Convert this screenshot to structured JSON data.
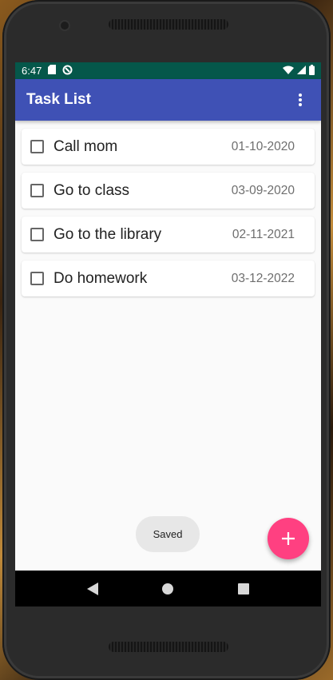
{
  "status_bar": {
    "time": "6:47",
    "icons_left": [
      "sd-card-icon",
      "sync-icon"
    ],
    "icons_right": [
      "wifi-icon",
      "signal-icon",
      "battery-icon"
    ],
    "color": "#05574a"
  },
  "app_bar": {
    "title": "Task List",
    "menu_icon": "more-vert-icon",
    "color": "#3f51b5"
  },
  "tasks": [
    {
      "title": "Call mom",
      "date": "01-10-2020",
      "checked": false
    },
    {
      "title": "Go to class",
      "date": "03-09-2020",
      "checked": false
    },
    {
      "title": "Go to the library",
      "date": "02-11-2021",
      "checked": false
    },
    {
      "title": "Do homework",
      "date": "03-12-2022",
      "checked": false
    }
  ],
  "toast": {
    "text": "Saved"
  },
  "fab": {
    "icon": "plus-icon",
    "color": "#ff4081"
  },
  "nav_bar": {
    "buttons": [
      "back-icon",
      "home-icon",
      "recents-icon"
    ]
  }
}
